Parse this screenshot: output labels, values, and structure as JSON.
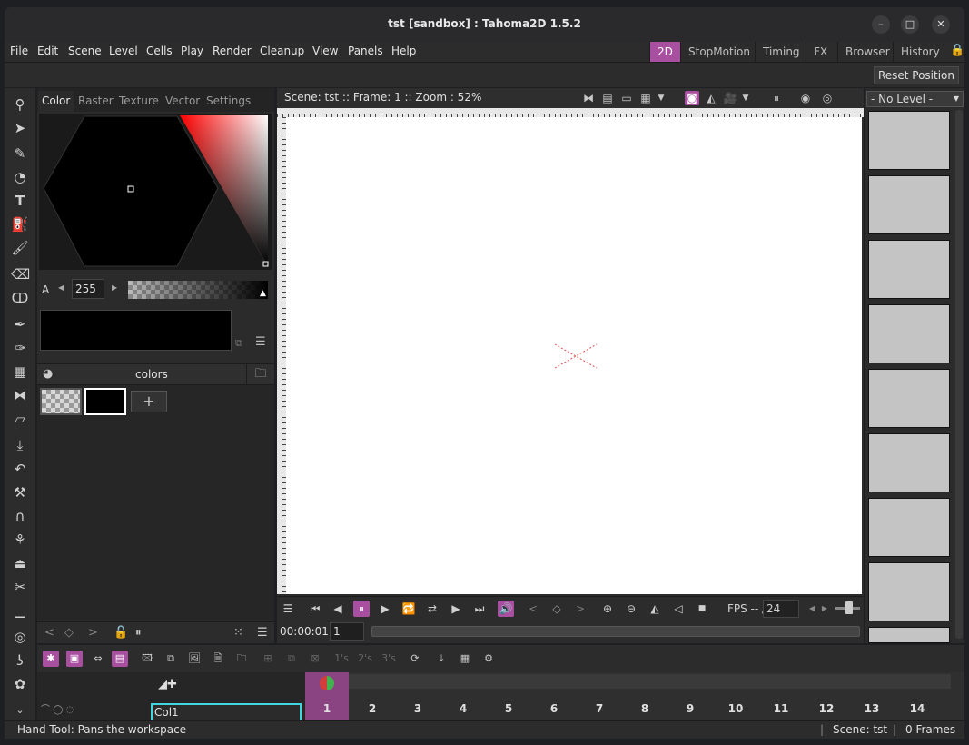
{
  "window": {
    "title": "tst [sandbox] : Tahoma2D 1.5.2",
    "minimize": "–",
    "maximize": "□",
    "close": "✕"
  },
  "menu": [
    "File",
    "Edit",
    "Scene",
    "Level",
    "Cells",
    "Play",
    "Render",
    "Cleanup",
    "View",
    "Panels",
    "Help"
  ],
  "rooms": [
    "2D",
    "StopMotion",
    "Timing",
    "FX",
    "Browser",
    "History"
  ],
  "active_room": "2D",
  "toolbar": {
    "reset_position": "Reset Position"
  },
  "style_editor": {
    "tabs": [
      "Color",
      "Raster",
      "Texture",
      "Vector",
      "Settings"
    ],
    "active_tab": "Color",
    "alpha_label": "A",
    "alpha_value": "255",
    "current_color": "#000000"
  },
  "palette": {
    "name": "colors",
    "add_label": "+"
  },
  "viewer": {
    "info": "Scene: tst  ::  Frame: 1  :: Zoom : 52%",
    "fps_label": "FPS -- /",
    "fps_value": "24",
    "timecode": "00:00:01",
    "frame": "1"
  },
  "level_strip": {
    "selected": "- No Level -"
  },
  "xsheet": {
    "column_name": "Col1",
    "frames": [
      "1",
      "2",
      "3",
      "4",
      "5",
      "6",
      "7",
      "8",
      "9",
      "10",
      "11",
      "12",
      "13",
      "14"
    ],
    "step_labels": [
      "1's",
      "2's",
      "3's"
    ]
  },
  "status": {
    "message": "Hand Tool: Pans the workspace",
    "scene": "Scene: tst",
    "frames": "0 Frames"
  },
  "colors": {
    "accent": "#a94fa0",
    "column_highlight": "#3fd6e0"
  }
}
